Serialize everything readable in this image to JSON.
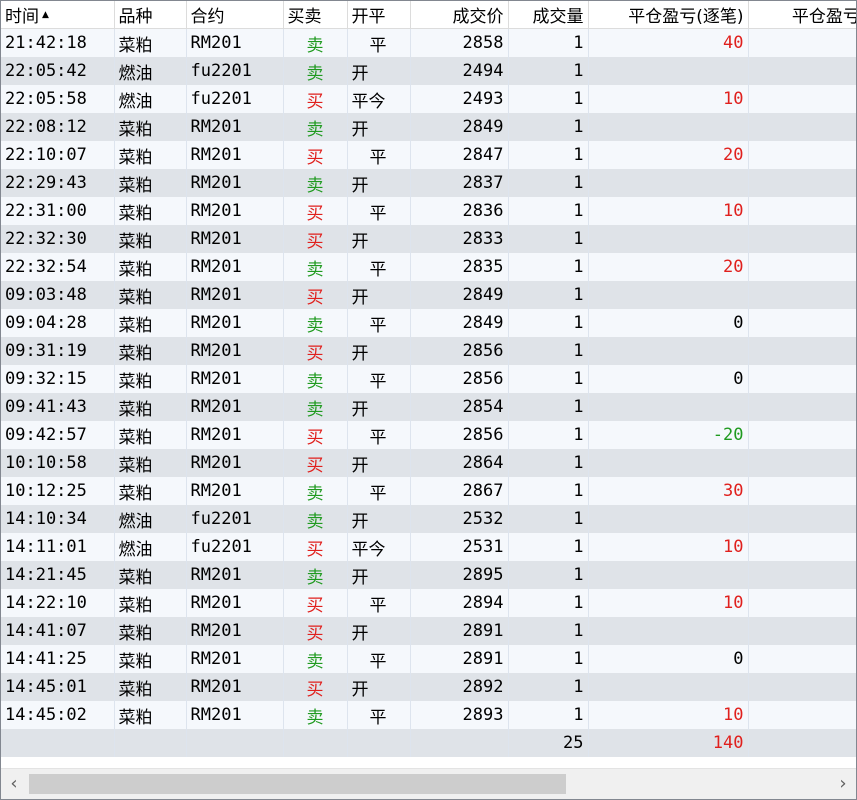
{
  "columns": [
    "时间",
    "品种",
    "合约",
    "买卖",
    "开平",
    "成交价",
    "成交量",
    "平仓盈亏(逐笔)",
    "平仓盈亏("
  ],
  "sort_indicator": "▲",
  "rows": [
    {
      "time": "21:42:18",
      "product": "菜粕",
      "contract": "RM201",
      "side": "卖",
      "oc": "平",
      "price": "2858",
      "qty": "1",
      "pnl": "40"
    },
    {
      "time": "22:05:42",
      "product": "燃油",
      "contract": "fu2201",
      "side": "卖",
      "oc": "开",
      "price": "2494",
      "qty": "1",
      "pnl": ""
    },
    {
      "time": "22:05:58",
      "product": "燃油",
      "contract": "fu2201",
      "side": "买",
      "oc": "平今",
      "price": "2493",
      "qty": "1",
      "pnl": "10"
    },
    {
      "time": "22:08:12",
      "product": "菜粕",
      "contract": "RM201",
      "side": "卖",
      "oc": "开",
      "price": "2849",
      "qty": "1",
      "pnl": ""
    },
    {
      "time": "22:10:07",
      "product": "菜粕",
      "contract": "RM201",
      "side": "买",
      "oc": "平",
      "price": "2847",
      "qty": "1",
      "pnl": "20"
    },
    {
      "time": "22:29:43",
      "product": "菜粕",
      "contract": "RM201",
      "side": "卖",
      "oc": "开",
      "price": "2837",
      "qty": "1",
      "pnl": ""
    },
    {
      "time": "22:31:00",
      "product": "菜粕",
      "contract": "RM201",
      "side": "买",
      "oc": "平",
      "price": "2836",
      "qty": "1",
      "pnl": "10"
    },
    {
      "time": "22:32:30",
      "product": "菜粕",
      "contract": "RM201",
      "side": "买",
      "oc": "开",
      "price": "2833",
      "qty": "1",
      "pnl": ""
    },
    {
      "time": "22:32:54",
      "product": "菜粕",
      "contract": "RM201",
      "side": "卖",
      "oc": "平",
      "price": "2835",
      "qty": "1",
      "pnl": "20"
    },
    {
      "time": "09:03:48",
      "product": "菜粕",
      "contract": "RM201",
      "side": "买",
      "oc": "开",
      "price": "2849",
      "qty": "1",
      "pnl": ""
    },
    {
      "time": "09:04:28",
      "product": "菜粕",
      "contract": "RM201",
      "side": "卖",
      "oc": "平",
      "price": "2849",
      "qty": "1",
      "pnl": "0"
    },
    {
      "time": "09:31:19",
      "product": "菜粕",
      "contract": "RM201",
      "side": "买",
      "oc": "开",
      "price": "2856",
      "qty": "1",
      "pnl": ""
    },
    {
      "time": "09:32:15",
      "product": "菜粕",
      "contract": "RM201",
      "side": "卖",
      "oc": "平",
      "price": "2856",
      "qty": "1",
      "pnl": "0"
    },
    {
      "time": "09:41:43",
      "product": "菜粕",
      "contract": "RM201",
      "side": "卖",
      "oc": "开",
      "price": "2854",
      "qty": "1",
      "pnl": ""
    },
    {
      "time": "09:42:57",
      "product": "菜粕",
      "contract": "RM201",
      "side": "买",
      "oc": "平",
      "price": "2856",
      "qty": "1",
      "pnl": "-20"
    },
    {
      "time": "10:10:58",
      "product": "菜粕",
      "contract": "RM201",
      "side": "买",
      "oc": "开",
      "price": "2864",
      "qty": "1",
      "pnl": ""
    },
    {
      "time": "10:12:25",
      "product": "菜粕",
      "contract": "RM201",
      "side": "卖",
      "oc": "平",
      "price": "2867",
      "qty": "1",
      "pnl": "30"
    },
    {
      "time": "14:10:34",
      "product": "燃油",
      "contract": "fu2201",
      "side": "卖",
      "oc": "开",
      "price": "2532",
      "qty": "1",
      "pnl": ""
    },
    {
      "time": "14:11:01",
      "product": "燃油",
      "contract": "fu2201",
      "side": "买",
      "oc": "平今",
      "price": "2531",
      "qty": "1",
      "pnl": "10"
    },
    {
      "time": "14:21:45",
      "product": "菜粕",
      "contract": "RM201",
      "side": "卖",
      "oc": "开",
      "price": "2895",
      "qty": "1",
      "pnl": ""
    },
    {
      "time": "14:22:10",
      "product": "菜粕",
      "contract": "RM201",
      "side": "买",
      "oc": "平",
      "price": "2894",
      "qty": "1",
      "pnl": "10"
    },
    {
      "time": "14:41:07",
      "product": "菜粕",
      "contract": "RM201",
      "side": "买",
      "oc": "开",
      "price": "2891",
      "qty": "1",
      "pnl": ""
    },
    {
      "time": "14:41:25",
      "product": "菜粕",
      "contract": "RM201",
      "side": "卖",
      "oc": "平",
      "price": "2891",
      "qty": "1",
      "pnl": "0"
    },
    {
      "time": "14:45:01",
      "product": "菜粕",
      "contract": "RM201",
      "side": "买",
      "oc": "开",
      "price": "2892",
      "qty": "1",
      "pnl": ""
    },
    {
      "time": "14:45:02",
      "product": "菜粕",
      "contract": "RM201",
      "side": "卖",
      "oc": "平",
      "price": "2893",
      "qty": "1",
      "pnl": "10"
    }
  ],
  "totals": {
    "qty": "25",
    "pnl": "140"
  },
  "scrollbar": {
    "left_arrow": "‹",
    "right_arrow": "›"
  },
  "colors": {
    "buy": "#e0201d",
    "sell": "#1f9a1f",
    "profit": "#e0201d",
    "loss": "#1f9a1f",
    "row_alt": "#dfe3e8",
    "row": "#f5f8fc"
  }
}
